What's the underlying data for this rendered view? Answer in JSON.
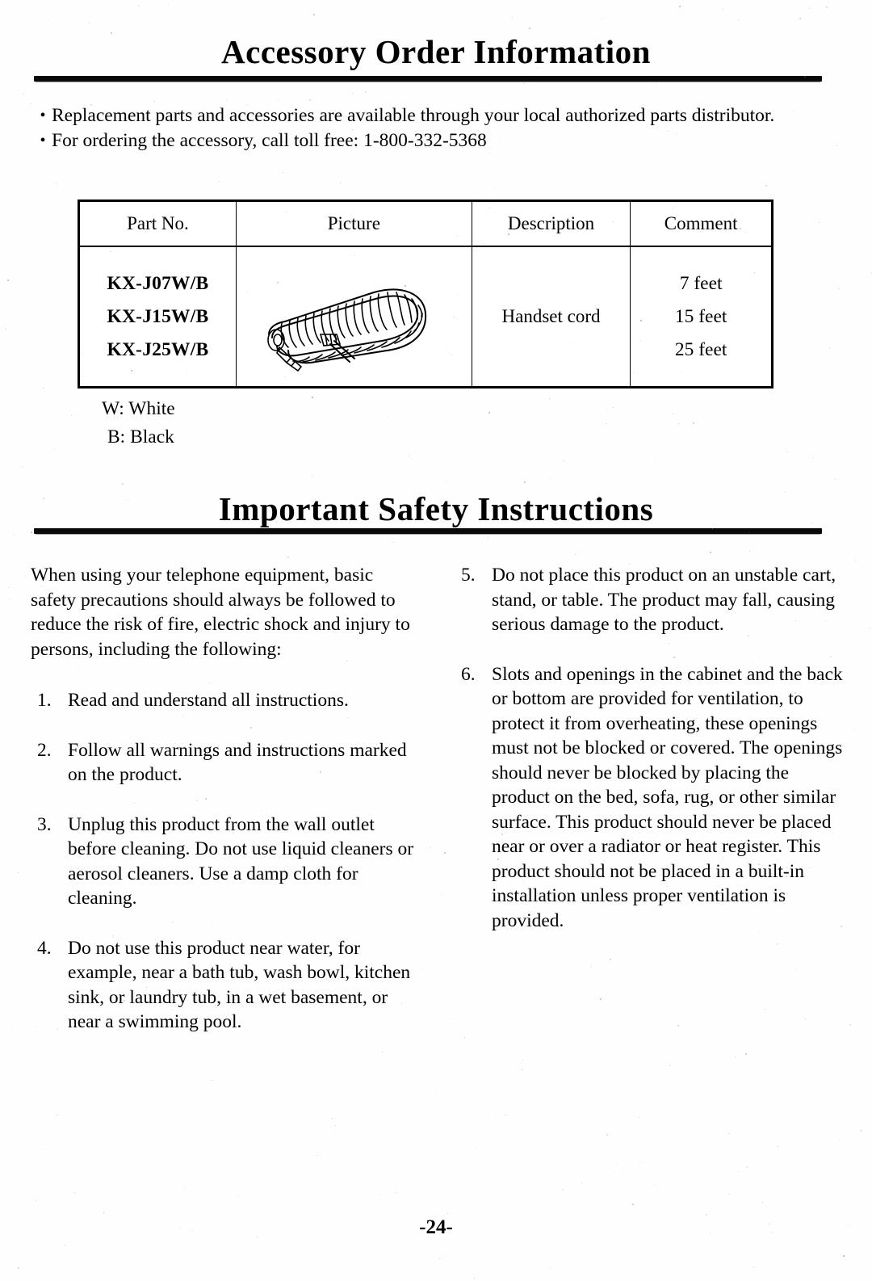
{
  "document": {
    "page_number": "-24-"
  },
  "accessory_section": {
    "heading": "Accessory Order Information",
    "bullets": [
      "Replacement parts and accessories are available through your local authorized parts distributor.",
      "For ordering the accessory, call toll free:  1-800-332-5368"
    ],
    "table": {
      "headers": [
        "Part No.",
        "Picture",
        "Description",
        "Comment"
      ],
      "rows": [
        {
          "part_numbers": [
            "KX-J07W/B",
            "KX-J15W/B",
            "KX-J25W/B"
          ],
          "picture": "handset-coiled-cord",
          "description": "Handset cord",
          "comments": [
            "7 feet",
            "15 feet",
            "25 feet"
          ]
        }
      ]
    },
    "legend": [
      "W: White",
      "B: Black"
    ]
  },
  "safety_section": {
    "heading": "Important Safety Instructions",
    "intro": "When using your telephone equipment, basic safety precautions should always be followed to reduce the risk of fire, electric shock and injury to persons, including the following:",
    "items": [
      {
        "number": "1.",
        "text": "Read and understand all instructions."
      },
      {
        "number": "2.",
        "text": "Follow all warnings and instructions marked on the product."
      },
      {
        "number": "3.",
        "text": "Unplug this product from the wall outlet before cleaning.  Do not use liquid cleaners or aerosol cleaners.  Use a damp cloth for cleaning."
      },
      {
        "number": "4.",
        "text": "Do not use this product near water, for example, near a bath tub, wash bowl, kitchen sink, or laundry tub, in a wet basement, or near a swimming pool."
      },
      {
        "number": "5.",
        "text": "Do not place this product on an unstable cart, stand, or table.  The product may fall, causing serious damage to the product."
      },
      {
        "number": "6.",
        "text": "Slots and openings in the cabinet and the back or bottom are provided for ventilation, to protect it from overheating, these openings must not be blocked or covered.  The openings should never be blocked by placing the product on the bed, sofa, rug, or other similar surface.  This product should never be placed near or over a radiator or heat register.  This product should not be placed in a built-in installation unless proper ventilation is provided."
      }
    ]
  },
  "colors": {
    "ink": "#000000",
    "paper": "#fefefe"
  }
}
